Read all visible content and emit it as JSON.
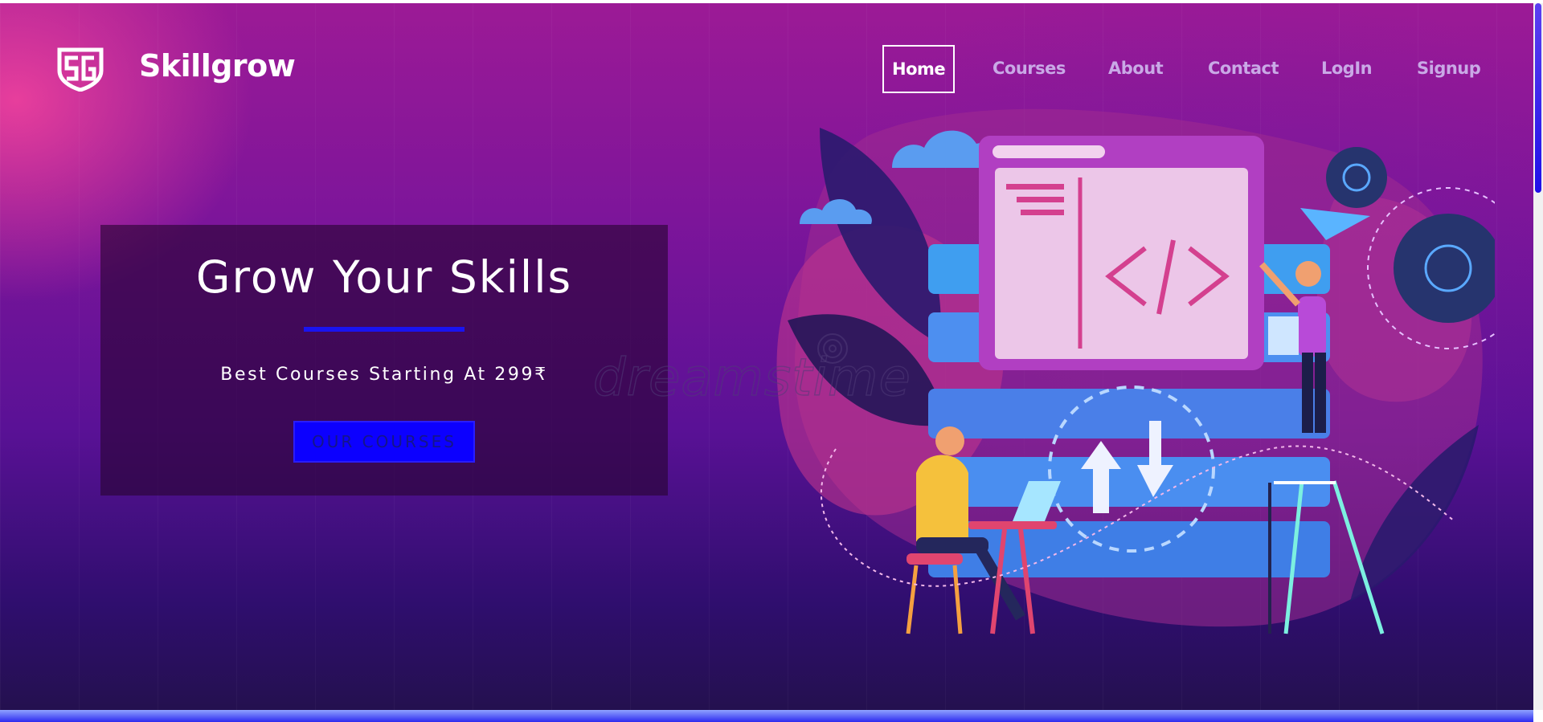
{
  "brand": {
    "name": "Skillgrow",
    "logo_icon": "sg-shield-logo-icon"
  },
  "nav": {
    "items": [
      {
        "label": "Home",
        "active": true
      },
      {
        "label": "Courses",
        "active": false
      },
      {
        "label": "About",
        "active": false
      },
      {
        "label": "Contact",
        "active": false
      },
      {
        "label": "LogIn",
        "active": false
      },
      {
        "label": "Signup",
        "active": false
      }
    ]
  },
  "hero": {
    "title": "Grow Your Skills",
    "subtitle": "Best Courses Starting At 299₹",
    "cta_label": "OUR COURSES",
    "watermark": "dreamstime"
  },
  "colors": {
    "accent_blue": "#0c00ff",
    "hero_top": "#9c1a96",
    "hero_bottom": "#24104f",
    "nav_inactive": "#c9a9e6"
  }
}
